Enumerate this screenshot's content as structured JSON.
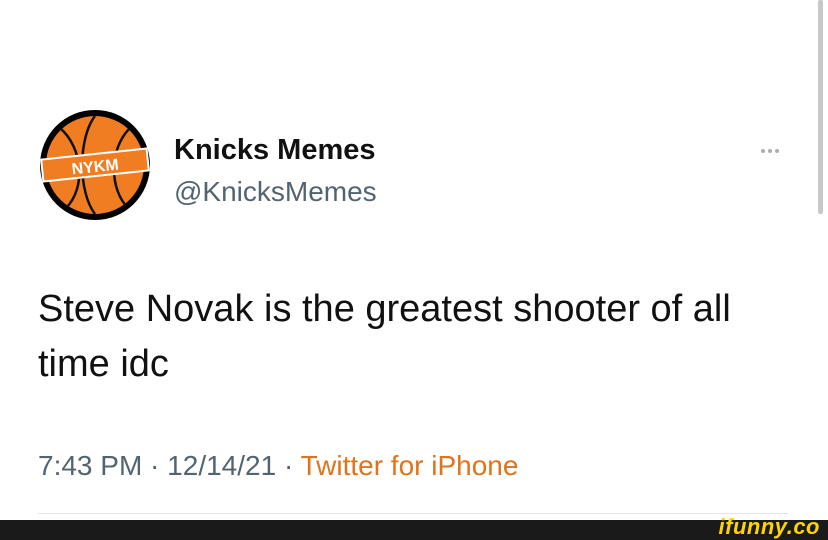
{
  "tweet": {
    "author": {
      "display_name": "Knicks Memes",
      "handle": "@KnicksMemes",
      "avatar_logo_text": "NYKM"
    },
    "more_icon": "more-horizontal-icon",
    "text": "Steve Novak is the greatest shooter of all time idc",
    "time": "7:43 PM",
    "separator": " · ",
    "date": "12/14/21",
    "source": "Twitter for iPhone"
  },
  "watermark": {
    "text": "ifunny.co"
  },
  "colors": {
    "text": "#111111",
    "secondary_text": "#536471",
    "source_link": "#e0731b",
    "avatar_ball": "#f07d22",
    "avatar_ring": "#000000",
    "watermark": "#ffd400",
    "footer_bar": "#1a1a1a"
  }
}
